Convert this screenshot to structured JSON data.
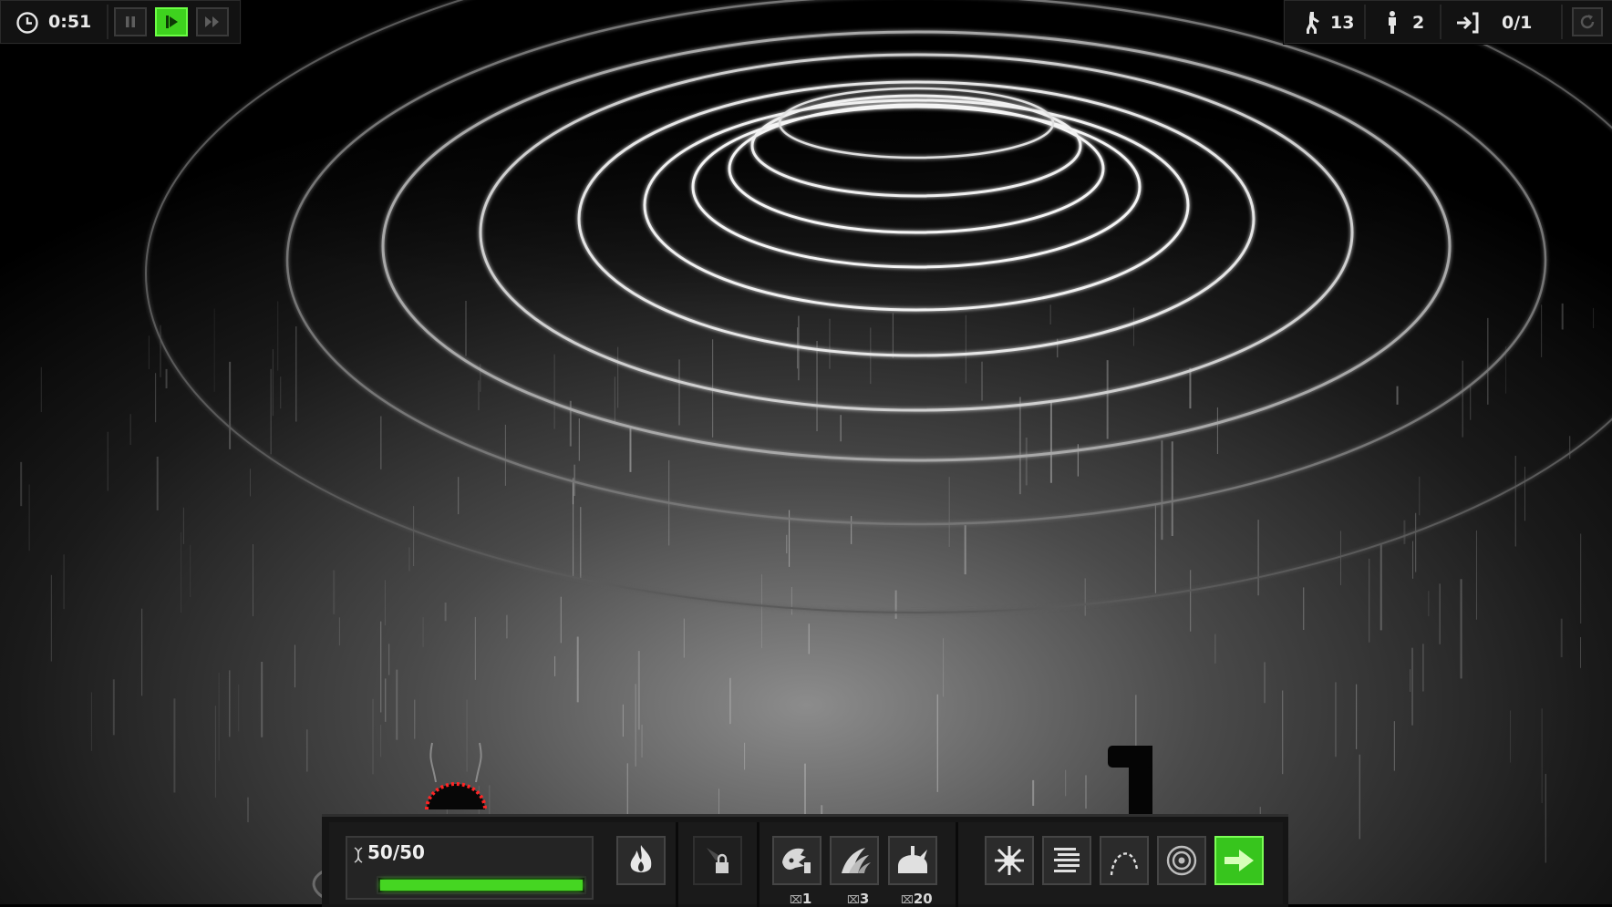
{
  "hud": {
    "timer": "0:51",
    "walkers_count": "13",
    "standing_count": "2",
    "exit_count": "0/1",
    "icons": {
      "clock": "clock-icon",
      "pause": "pause-icon",
      "play": "play-icon",
      "fast_forward": "fast-forward-icon",
      "walker": "walking-figure-icon",
      "standing": "standing-figure-icon",
      "exit": "exit-icon",
      "restart": "restart-icon"
    }
  },
  "toolbar": {
    "dna_label": "50/50",
    "dna_fraction": 1.0,
    "abilities": [
      {
        "name": "horn-flail",
        "cost": "1"
      },
      {
        "name": "claws",
        "cost": "3"
      },
      {
        "name": "spiked-dome",
        "cost": "20"
      }
    ],
    "actions": [
      "burst",
      "dash",
      "leap",
      "target",
      "proceed"
    ]
  },
  "colors": {
    "accent_green": "#3ed21e",
    "bar_green": "#45d622",
    "danger_red": "#ff2424"
  }
}
